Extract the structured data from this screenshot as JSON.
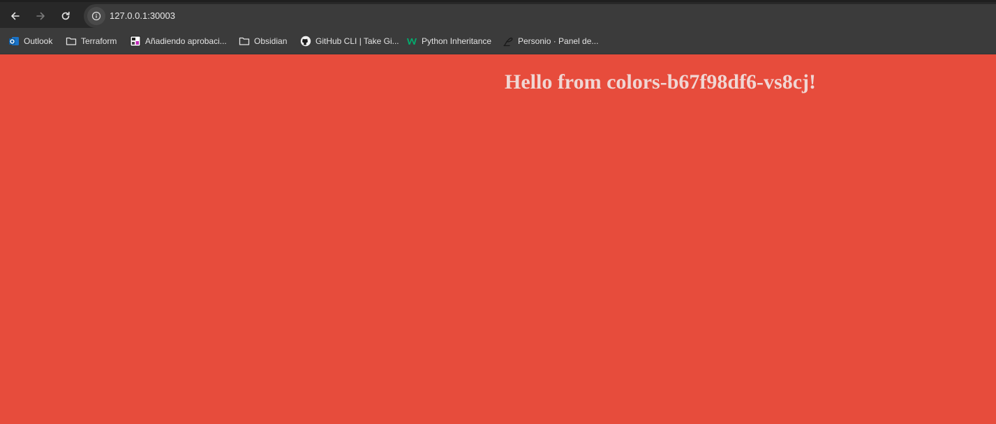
{
  "browser": {
    "url": "127.0.0.1:30003",
    "nav": {
      "back_icon": "arrow-left-icon",
      "forward_icon": "arrow-right-icon",
      "reload_icon": "reload-icon",
      "site_info_icon": "info-circle-icon"
    },
    "bookmarks": [
      {
        "label": "Outlook",
        "icon": "outlook-icon"
      },
      {
        "label": "Terraform",
        "icon": "folder-icon"
      },
      {
        "label": "Añadiendo aprobaci...",
        "icon": "app-icon"
      },
      {
        "label": "Obsidian",
        "icon": "folder-icon"
      },
      {
        "label": "GitHub CLI | Take Gi...",
        "icon": "github-icon"
      },
      {
        "label": "Python Inheritance",
        "icon": "w3schools-icon"
      },
      {
        "label": "Personio · Panel de...",
        "icon": "personio-icon"
      }
    ]
  },
  "page": {
    "heading": "Hello from colors-b67f98df6-vs8cj!",
    "background_color": "#e74c3c",
    "heading_color": "#f0d6d3"
  }
}
